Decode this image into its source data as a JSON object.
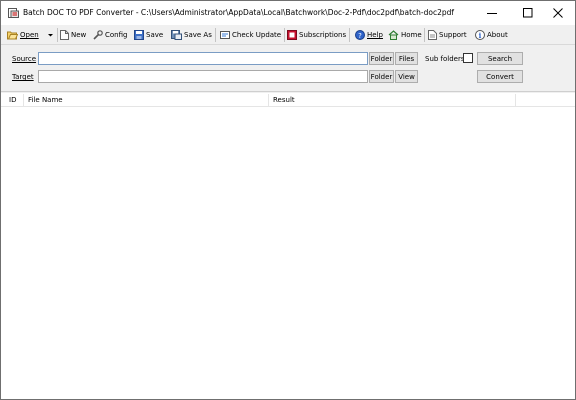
{
  "window": {
    "title": "Batch DOC TO PDF Converter - C:\\Users\\Administrator\\AppData\\Local\\Batchwork\\Doc-2-Pdf\\doc2pdf\\batch-doc2pdf"
  },
  "toolbar": {
    "open": "Open",
    "new": "New",
    "config": "Config",
    "save": "Save",
    "save_as": "Save As",
    "check_update": "Check Update",
    "subscriptions": "Subscriptions",
    "help": "Help",
    "home": "Home",
    "support": "Support",
    "about": "About"
  },
  "form": {
    "source_label": "Source",
    "target_label": "Target",
    "source_value": "",
    "target_value": "",
    "folder_button": "Folder",
    "files_button": "Files",
    "folder_button_2": "Folder",
    "view_button": "View",
    "subfolders_label": "Sub folders",
    "search_button": "Search",
    "convert_button": "Convert"
  },
  "list": {
    "columns": [
      "ID",
      "File Name",
      "Result"
    ]
  },
  "icons": {
    "app": "pdf-app-icon",
    "open": "folder-open-icon",
    "new": "new-document-icon",
    "config": "wrench-icon",
    "save": "floppy-disk-icon",
    "save_as": "save-as-icon",
    "check_update": "update-icon",
    "subscriptions": "subscriptions-icon",
    "help": "help-icon",
    "home": "home-icon",
    "support": "support-icon",
    "about": "info-icon"
  }
}
